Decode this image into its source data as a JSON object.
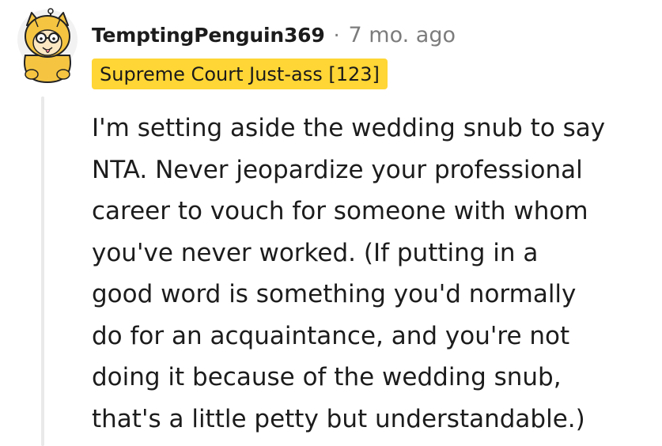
{
  "comment": {
    "author": "TemptingPenguin369",
    "separator": "·",
    "timestamp": "7 mo. ago",
    "flair": "Supreme Court Just-ass [123]",
    "flair_color": "#ffd635",
    "avatar_icon": "avatar-icon",
    "body_lines": [
      "I'm setting aside the wedding snub to say",
      "NTA. Never jeopardize your professional",
      "career to vouch for someone with whom",
      "you've never worked. (If putting in a",
      "good word is something you'd normally",
      "do for an acquaintance, and you're not",
      "doing it because of the wedding snub,",
      "that's a little petty but understandable.)"
    ]
  }
}
